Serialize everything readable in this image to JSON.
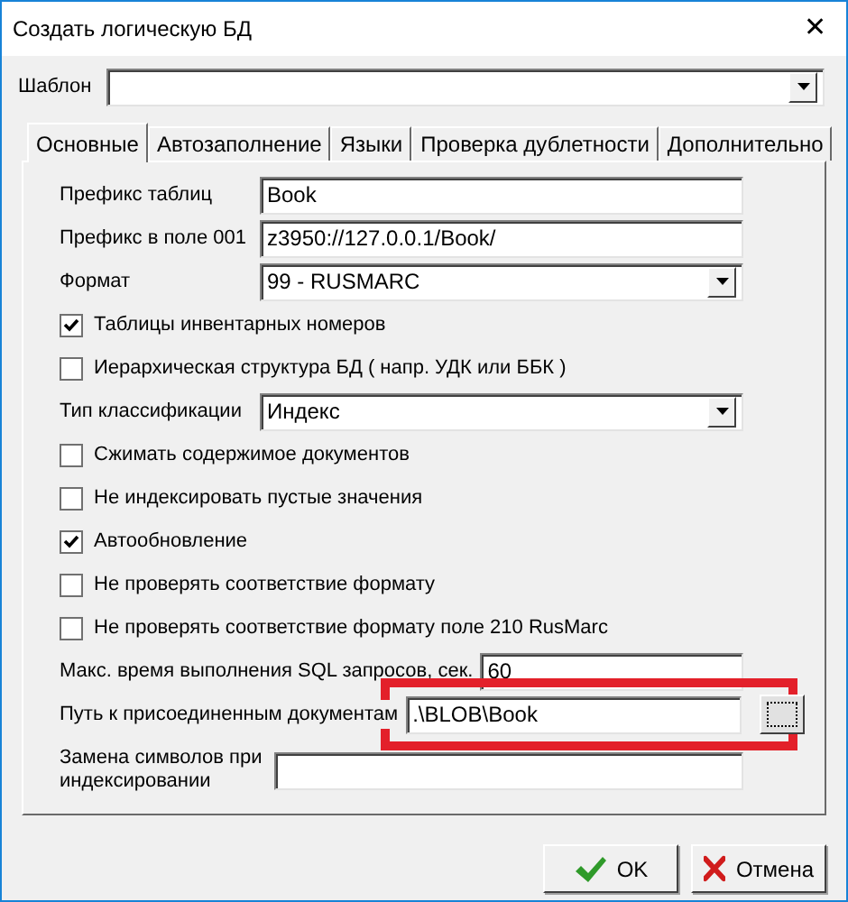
{
  "window": {
    "title": "Создать логическую БД",
    "close": "✕"
  },
  "template": {
    "label": "Шаблон"
  },
  "tabs": [
    {
      "label": "Основные",
      "selected": true
    },
    {
      "label": "Автозаполнение",
      "selected": false
    },
    {
      "label": "Языки",
      "selected": false
    },
    {
      "label": "Проверка дублетности",
      "selected": false
    },
    {
      "label": "Дополнительно",
      "selected": false
    }
  ],
  "fields": [
    {
      "kind": "text",
      "label": "Префикс таблиц",
      "value": "Book"
    },
    {
      "kind": "text",
      "label": "Префикс в поле 001",
      "value": "z3950://127.0.0.1/Book/"
    },
    {
      "kind": "select",
      "label": "Формат",
      "value": "99 - RUSMARC"
    },
    {
      "kind": "checkbox",
      "label": "Таблицы инвентарных номеров",
      "checked": true
    },
    {
      "kind": "checkbox",
      "label": "Иерархическая структура БД ( напр. УДК или ББК )",
      "checked": false
    },
    {
      "kind": "select",
      "label": "Тип классификации",
      "value": "Индекс"
    },
    {
      "kind": "checkbox",
      "label": "Сжимать содержимое документов",
      "checked": false
    },
    {
      "kind": "checkbox",
      "label": "Не индексировать пустые значения",
      "checked": false
    },
    {
      "kind": "checkbox",
      "label": "Автообновление",
      "checked": true
    },
    {
      "kind": "checkbox",
      "label": "Не проверять соответствие формату",
      "checked": false
    },
    {
      "kind": "checkbox",
      "label": "Не проверять соответствие формату поле 210 RusMarc",
      "checked": false
    },
    {
      "kind": "text",
      "label": "Макс. время выполнения SQL запросов, сек.",
      "value": "60"
    },
    {
      "kind": "path",
      "label": "Путь к присоединенным документам",
      "value": ".\\BLOB\\Book",
      "highlighted": true
    },
    {
      "kind": "memo",
      "label": "Замена символов при индексировании"
    }
  ],
  "buttons": [
    {
      "kind": "ok",
      "label": "OK"
    },
    {
      "kind": "cancel",
      "label": "Отмена"
    }
  ]
}
